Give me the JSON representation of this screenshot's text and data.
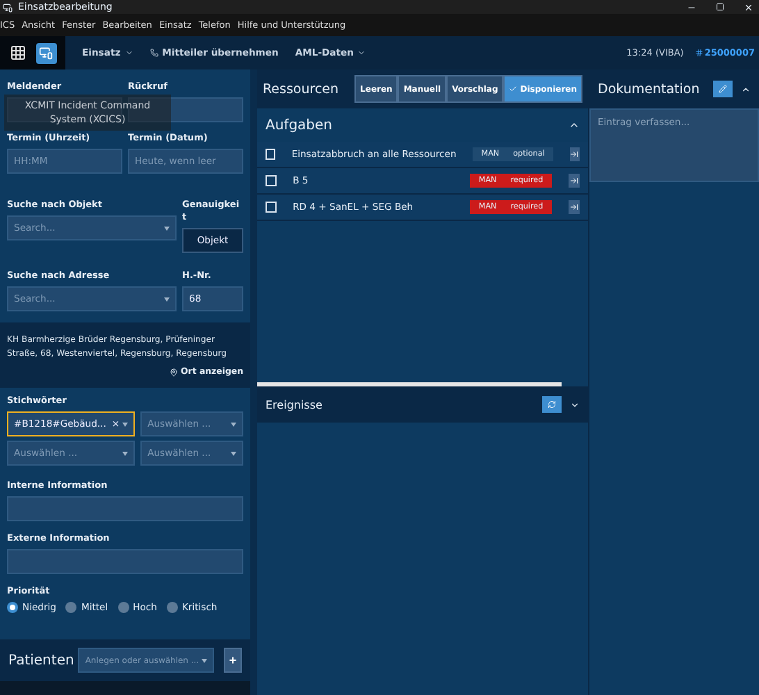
{
  "window": {
    "title": "Einsatzbearbeitung"
  },
  "menu": [
    "ICS",
    "Ansicht",
    "Fenster",
    "Bearbeiten",
    "Einsatz",
    "Telefon",
    "Hilfe und Unterstützung"
  ],
  "toolbar": {
    "items": [
      {
        "label": "Einsatz",
        "kind": "dropdown"
      },
      {
        "label": "Mitteiler übernehmen",
        "kind": "action"
      },
      {
        "label": "AML-Daten",
        "kind": "dropdown"
      }
    ],
    "time": "13:24 (VIBA)",
    "incident_number": "25000007"
  },
  "tooltip": "XCMIT Incident Command System (XCICS)",
  "form": {
    "caller_label": "Meldender",
    "callback_label": "Rückruf",
    "time_label": "Termin (Uhrzeit)",
    "time_placeholder": "HH:MM",
    "date_label": "Termin (Datum)",
    "date_placeholder": "Heute, wenn leer",
    "object_label": "Suche nach Objekt",
    "object_placeholder": "Search...",
    "accuracy_label": "Genauigkeit",
    "accuracy_value": "Objekt",
    "address_label": "Suche nach Adresse",
    "address_placeholder": "Search...",
    "house_label": "H.-Nr.",
    "house_value": "68"
  },
  "address": {
    "text": "KH Barmherzige Brüder Regensburg, Prüfeninger Straße, 68, Westenviertel, Regensburg, Regensburg",
    "link": "Ort anzeigen"
  },
  "keywords": {
    "label": "Stichwörter",
    "selects": [
      {
        "value": "#B1218#Gebäud...",
        "clear": "×",
        "focused": true
      },
      {
        "placeholder": "Auswählen ...",
        "focused": false
      },
      {
        "placeholder": "Auswählen ...",
        "focused": false
      },
      {
        "placeholder": "Auswählen ...",
        "focused": false
      }
    ]
  },
  "internal": {
    "label": "Interne Information"
  },
  "external": {
    "label": "Externe Information"
  },
  "priority": {
    "label": "Priorität",
    "options": [
      {
        "label": "Niedrig",
        "selected": true
      },
      {
        "label": "Mittel",
        "selected": false
      },
      {
        "label": "Hoch",
        "selected": false
      },
      {
        "label": "Kritisch",
        "selected": false
      }
    ]
  },
  "patients": {
    "label": "Patienten",
    "placeholder": "Anlegen oder auswählen ...",
    "add": "+"
  },
  "resources": {
    "title": "Ressourcen",
    "buttons": [
      {
        "label": "Leeren",
        "selected": false
      },
      {
        "label": "Manuell",
        "selected": false
      },
      {
        "label": "Vorschlag",
        "selected": false
      },
      {
        "label": "Disponieren",
        "selected": true
      }
    ]
  },
  "tasks": {
    "title": "Aufgaben",
    "rows": [
      {
        "label": "Einsatzabbruch an alle Ressourcen",
        "checked": false,
        "tag": "MAN",
        "requirement": "optional",
        "required": false
      },
      {
        "label": "B 5",
        "checked": false,
        "tag": "MAN",
        "requirement": "required",
        "required": true
      },
      {
        "label": "RD 4 + SanEL + SEG Beh",
        "checked": false,
        "tag": "MAN",
        "requirement": "required",
        "required": true
      }
    ]
  },
  "documentation": {
    "title": "Dokumentation",
    "placeholder": "Eintrag verfassen..."
  },
  "events": {
    "title": "Ereignisse"
  }
}
